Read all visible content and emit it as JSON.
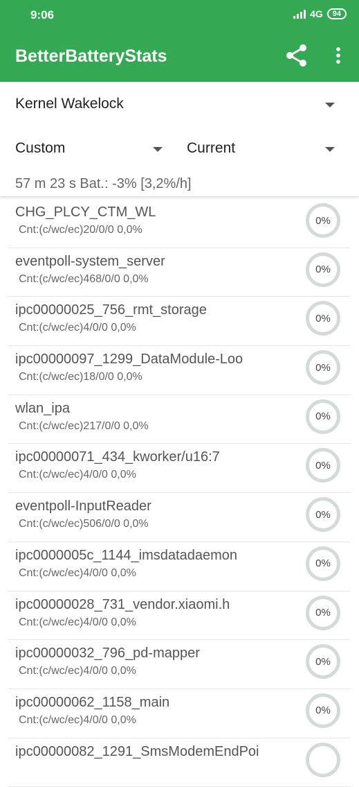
{
  "status": {
    "time": "9:06",
    "network": "4G",
    "battery": "94"
  },
  "appbar": {
    "title": "BetterBatteryStats"
  },
  "controls": {
    "stat_type": "Kernel Wakelock",
    "from": "Custom",
    "to": "Current",
    "summary": "57 m 23 s  Bat.: -3% [3,2%/h]"
  },
  "wakelocks": [
    {
      "name": "CHG_PLCY_CTM_WL",
      "count": "Cnt:(c/wc/ec)20/0/0 0,0%",
      "pct": "0%"
    },
    {
      "name": "eventpoll-system_server",
      "count": "Cnt:(c/wc/ec)468/0/0 0,0%",
      "pct": "0%"
    },
    {
      "name": "ipc00000025_756_rmt_storage",
      "count": "Cnt:(c/wc/ec)4/0/0 0,0%",
      "pct": "0%"
    },
    {
      "name": "ipc00000097_1299_DataModule-Loo",
      "count": "Cnt:(c/wc/ec)18/0/0 0,0%",
      "pct": "0%"
    },
    {
      "name": "wlan_ipa",
      "count": "Cnt:(c/wc/ec)217/0/0 0,0%",
      "pct": "0%"
    },
    {
      "name": "ipc00000071_434_kworker/u16:7",
      "count": "Cnt:(c/wc/ec)4/0/0 0,0%",
      "pct": "0%"
    },
    {
      "name": "eventpoll-InputReader",
      "count": "Cnt:(c/wc/ec)506/0/0 0,0%",
      "pct": "0%"
    },
    {
      "name": "ipc0000005c_1144_imsdatadaemon",
      "count": "Cnt:(c/wc/ec)4/0/0 0,0%",
      "pct": "0%"
    },
    {
      "name": "ipc00000028_731_vendor.xiaomi.h",
      "count": "Cnt:(c/wc/ec)4/0/0 0,0%",
      "pct": "0%"
    },
    {
      "name": "ipc00000032_796_pd-mapper",
      "count": "Cnt:(c/wc/ec)4/0/0 0,0%",
      "pct": "0%"
    },
    {
      "name": "ipc00000062_1158_main",
      "count": "Cnt:(c/wc/ec)4/0/0 0,0%",
      "pct": "0%"
    },
    {
      "name": "ipc00000082_1291_SmsModemEndPoi",
      "count": "",
      "pct": ""
    }
  ],
  "colors": {
    "primary": "#34a853",
    "ring": "#d4dbd6"
  }
}
